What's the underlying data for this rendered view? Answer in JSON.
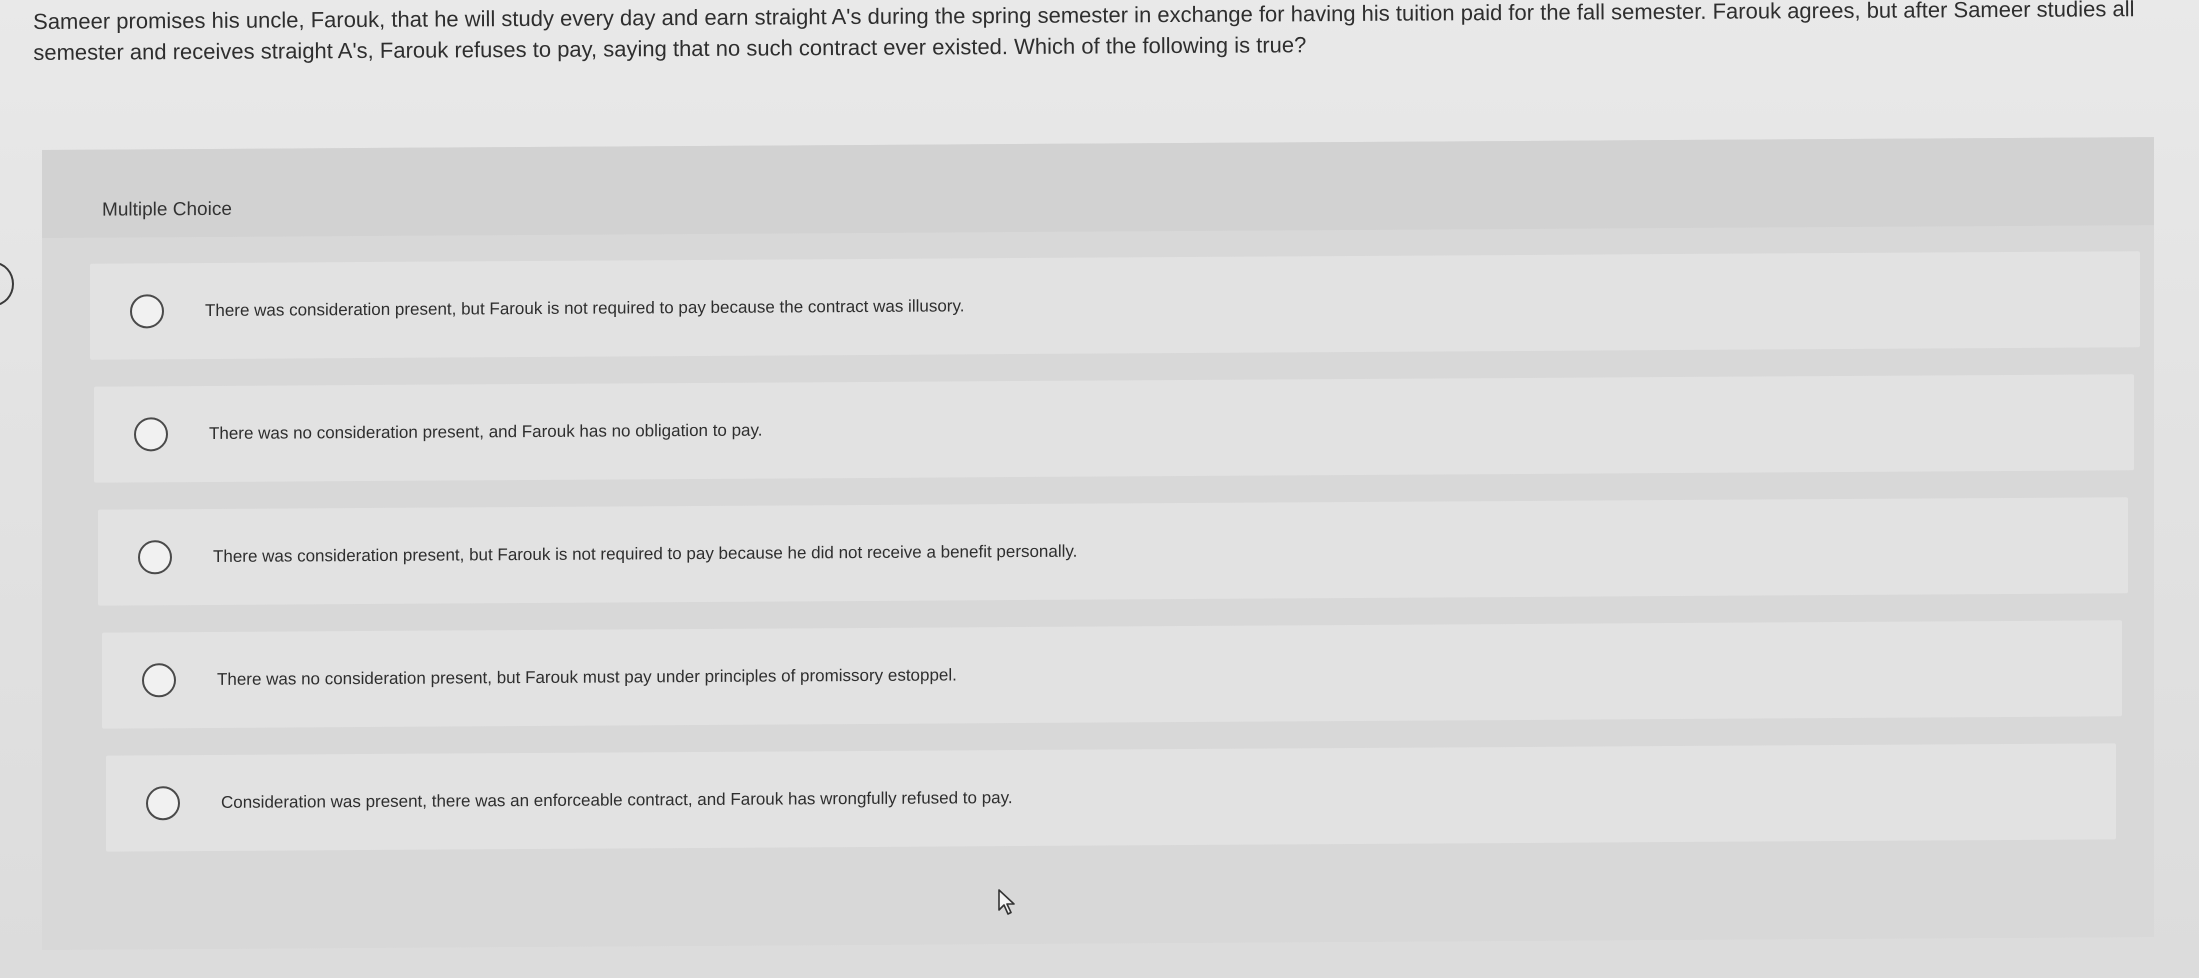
{
  "question": {
    "text": "Sameer promises his uncle, Farouk, that he will study every day and earn straight A's during the spring semester in exchange for having his tuition paid for the fall semester. Farouk agrees, but after Sameer studies all semester and receives straight A's, Farouk refuses to pay, saying that no such contract ever existed. Which of the following is true?"
  },
  "panel": {
    "section_label": "Multiple Choice"
  },
  "choices": [
    {
      "label": "There was consideration present, but Farouk is not required to pay because the contract was illusory."
    },
    {
      "label": "There was no consideration present, and Farouk has no obligation to pay."
    },
    {
      "label": "There was consideration present, but Farouk is not required to pay because he did not receive a benefit personally."
    },
    {
      "label": "There was no consideration present, but Farouk must pay under principles of promissory estoppel."
    },
    {
      "label": "Consideration was present, there was an enforceable contract, and Farouk has wrongfully refused to pay."
    }
  ],
  "icons": {
    "radio": "radio-circle-icon",
    "cursor": "mouse-pointer-icon",
    "side": "side-tab-icon"
  }
}
